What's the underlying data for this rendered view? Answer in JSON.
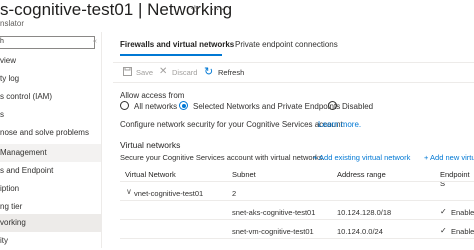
{
  "header": {
    "title": "s-cognitive-test01 | Networking",
    "subtitle": "nslator",
    "pin_icon": "☆",
    "more_icon": "···"
  },
  "sidebar": {
    "search_text": "h",
    "collapse_text": "«",
    "items": [
      {
        "label": "view"
      },
      {
        "label": "ty log"
      },
      {
        "label": "s control (IAM)"
      },
      {
        "label": "s"
      },
      {
        "label": "nose and solve problems"
      },
      {
        "label": " Management"
      },
      {
        "label": "s and Endpoint"
      },
      {
        "label": "iption"
      },
      {
        "label": "ng tier"
      },
      {
        "label": "vorking"
      },
      {
        "label": "ity"
      }
    ]
  },
  "tabs": [
    {
      "label": "Firewalls and virtual networks"
    },
    {
      "label": "Private endpoint connections"
    }
  ],
  "toolbar": {
    "save_label": "Save",
    "discard_label": "Discard",
    "refresh_label": "Refresh"
  },
  "access": {
    "label": "Allow access from",
    "options": [
      {
        "label": "All networks",
        "selected": false
      },
      {
        "label": "Selected Networks and Private Endpoints",
        "selected": true
      },
      {
        "label": "Disabled",
        "selected": false
      }
    ],
    "config_text": "Configure network security for your Cognitive Services account.",
    "learn_more": "Learn more."
  },
  "vnets": {
    "title": "Virtual networks",
    "description": "Secure your Cognitive Services account with virtual networks.",
    "add_existing": "+ Add existing virtual network",
    "add_new": "+ Add new virtu",
    "columns": [
      "Virtual Network",
      "Subnet",
      "Address range",
      "Endpoint S"
    ],
    "group": {
      "name": "vnet-cognitive-test01",
      "count": "2"
    },
    "rows": [
      {
        "subnet": "snet-aks-cognitive-test01",
        "address": "10.124.128.0/18",
        "status": "Enable"
      },
      {
        "subnet": "snet-vm-cognitive-test01",
        "address": "10.124.0.0/24",
        "status": "Enable"
      }
    ]
  },
  "colors": {
    "accent": "#0078d4",
    "selected_nav": "#edebe9",
    "section_bg": "#f3f2f1"
  }
}
